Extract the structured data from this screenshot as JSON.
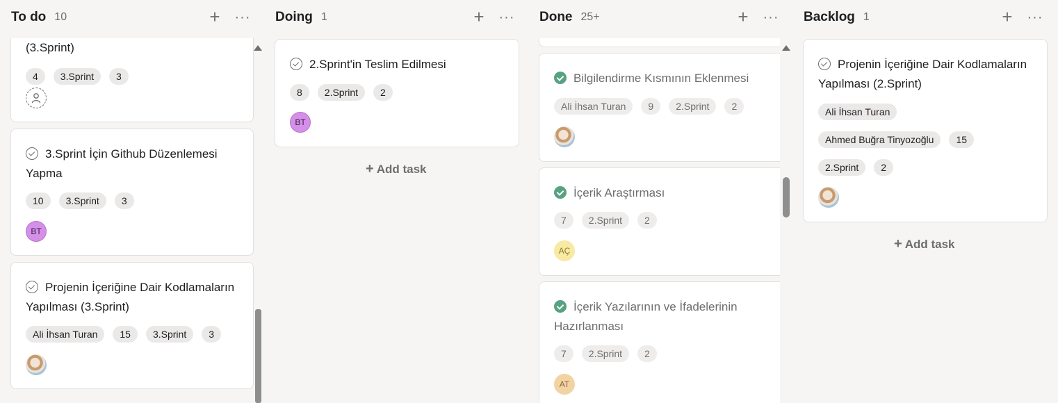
{
  "columns": [
    {
      "title": "To do",
      "count": "10"
    },
    {
      "title": "Doing",
      "count": "1"
    },
    {
      "title": "Done",
      "count": "25+"
    },
    {
      "title": "Backlog",
      "count": "1"
    }
  ],
  "todo": {
    "partial_card": {
      "title_tail": "(3.Sprint)",
      "tags": [
        "4",
        "3.Sprint",
        "3"
      ]
    },
    "card1": {
      "title": "3.Sprint İçin Github Düzenlemesi Yapma",
      "tags": [
        "10",
        "3.Sprint",
        "3"
      ],
      "avatar": "BT"
    },
    "card2": {
      "title": "Projenin İçeriğine Dair Kodlamaların Yapılması (3.Sprint)",
      "tags": [
        "Ali İhsan Turan",
        "15",
        "3.Sprint",
        "3"
      ]
    }
  },
  "doing": {
    "card1": {
      "title": "2.Sprint'in Teslim Edilmesi",
      "tags": [
        "8",
        "2.Sprint",
        "2"
      ],
      "avatar": "BT"
    },
    "add_task": "Add task"
  },
  "done": {
    "card1": {
      "title": "Bilgilendirme Kısmının Eklenmesi",
      "tags": [
        "Ali İhsan Turan",
        "9",
        "2.Sprint",
        "2"
      ]
    },
    "card2": {
      "title": "İçerik Araştırması",
      "tags": [
        "7",
        "2.Sprint",
        "2"
      ],
      "avatar": "AÇ"
    },
    "card3": {
      "title": "İçerik Yazılarının ve İfadelerinin Hazırlanması",
      "tags": [
        "7",
        "2.Sprint",
        "2"
      ],
      "avatar": "AT"
    }
  },
  "backlog": {
    "card1": {
      "title": "Projenin İçeriğine Dair Kodlamaların Yapılması (2.Sprint)",
      "tags_row1": [
        "Ali İhsan Turan"
      ],
      "tags_row2": [
        "Ahmed Buğra Tinyozoğlu",
        "15"
      ],
      "tags_row3": [
        "2.Sprint",
        "2"
      ]
    },
    "add_task": "Add task"
  },
  "colors": {
    "background": "#f6f5f4",
    "done_check": "#58a182",
    "avatar_bt": "#d490e8",
    "avatar_ac": "#f8e9a3",
    "avatar_at": "#f2d3a3"
  },
  "icons": {
    "add": "plus-icon",
    "more": "more-icon",
    "check": "check-circle-icon",
    "unassigned": "user-outline-icon",
    "scroll": "scroll-up-arrow-icon"
  }
}
